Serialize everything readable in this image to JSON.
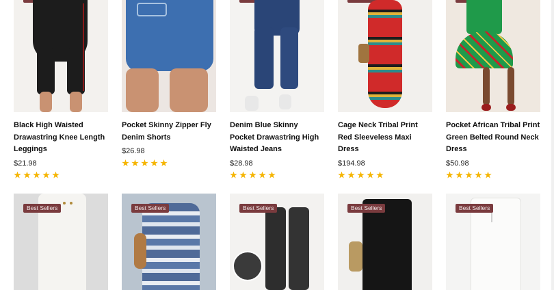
{
  "products_row1": [
    {
      "name": "Black High Waisted Drawastring Knee Length Leggings",
      "price": "$21.98",
      "rating": 5
    },
    {
      "name": "Pocket Skinny Zipper Fly Denim Shorts",
      "price": "$26.98",
      "rating": 5
    },
    {
      "name": "Denim Blue Skinny Pocket Drawastring High Waisted Jeans",
      "price": "$28.98",
      "rating": 5
    },
    {
      "name": "Cage Neck Tribal Print Red Sleeveless Maxi Dress",
      "price": "$194.98",
      "rating": 5
    },
    {
      "name": "Pocket African Tribal Print Green Belted Round Neck Dress",
      "price": "$50.98",
      "rating": 5
    }
  ],
  "products_row2": [
    {
      "badge": "Best Sellers"
    },
    {
      "badge": "Best Sellers"
    },
    {
      "badge": "Best Sellers"
    },
    {
      "badge": "Best Sellers"
    },
    {
      "badge": "Best Sellers"
    }
  ],
  "colors": {
    "badge": "#7a3b3e",
    "star": "#f5b400"
  }
}
